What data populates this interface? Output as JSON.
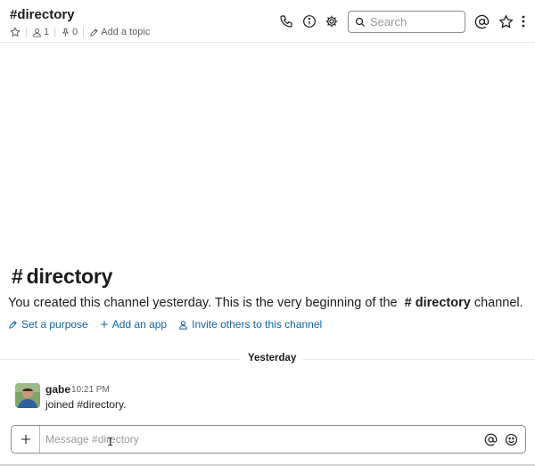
{
  "header": {
    "channel_title": "#directory",
    "member_count": "1",
    "pinned_count": "0",
    "add_topic": "Add a topic",
    "search_placeholder": "Search"
  },
  "intro": {
    "hash": "#",
    "channel_name": "directory",
    "text_before": "You created this channel yesterday. This is the very beginning of the",
    "channel_ref": "# directory",
    "text_after": " channel.",
    "actions": {
      "set_purpose": "Set a purpose",
      "add_app": "Add an app",
      "invite": "Invite others to this channel"
    }
  },
  "divider": {
    "label": "Yesterday"
  },
  "message": {
    "author": "gabe",
    "time": "10:21 PM",
    "text": "joined #directory."
  },
  "composer": {
    "placeholder": "Message #directory"
  },
  "colors": {
    "link": "#1264a3",
    "text": "#1d1c1d",
    "muted": "#616061",
    "border": "#8d8d8d"
  }
}
